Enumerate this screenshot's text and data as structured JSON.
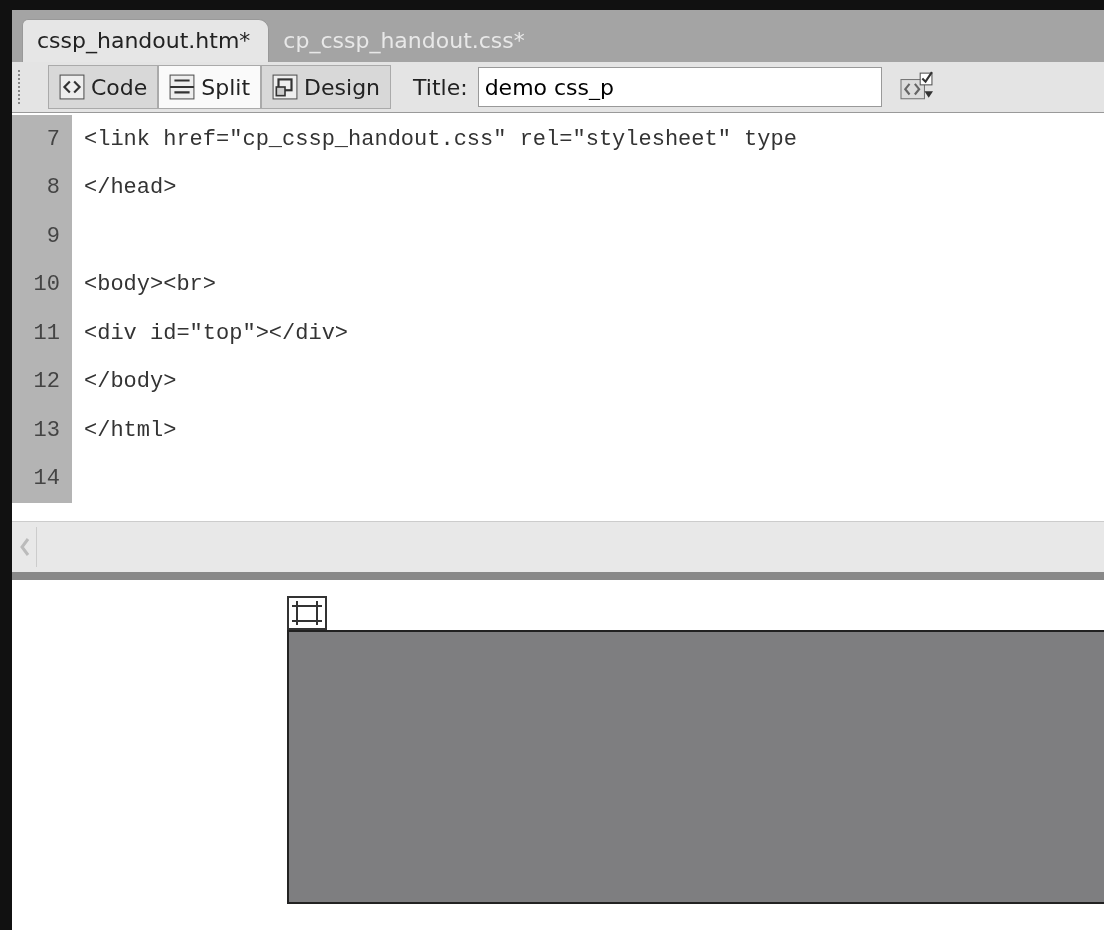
{
  "tabs": [
    {
      "label": "cssp_handout.htm*",
      "selected": true
    },
    {
      "label": "cp_cssp_handout.css*",
      "selected": false
    }
  ],
  "toolbar": {
    "modes": [
      {
        "label": "Code",
        "kind": "code",
        "selected": false
      },
      {
        "label": "Split",
        "kind": "split",
        "selected": true
      },
      {
        "label": "Design",
        "kind": "design",
        "selected": false
      }
    ],
    "title_label": "Title:",
    "title_value": "demo css_p"
  },
  "code_lines": [
    {
      "number": "7",
      "text": "<link href=\"cp_cssp_handout.css\" rel=\"stylesheet\" type"
    },
    {
      "number": "8",
      "text": "</head>"
    },
    {
      "number": "9"
    },
    {
      "number": "10",
      "text": "<body><br>"
    },
    {
      "number": "11",
      "text": "<div id=\"top\"></div>"
    },
    {
      "number": "12",
      "text": "</body>"
    },
    {
      "number": "13",
      "text": "</html>"
    },
    {
      "number": "14"
    }
  ]
}
